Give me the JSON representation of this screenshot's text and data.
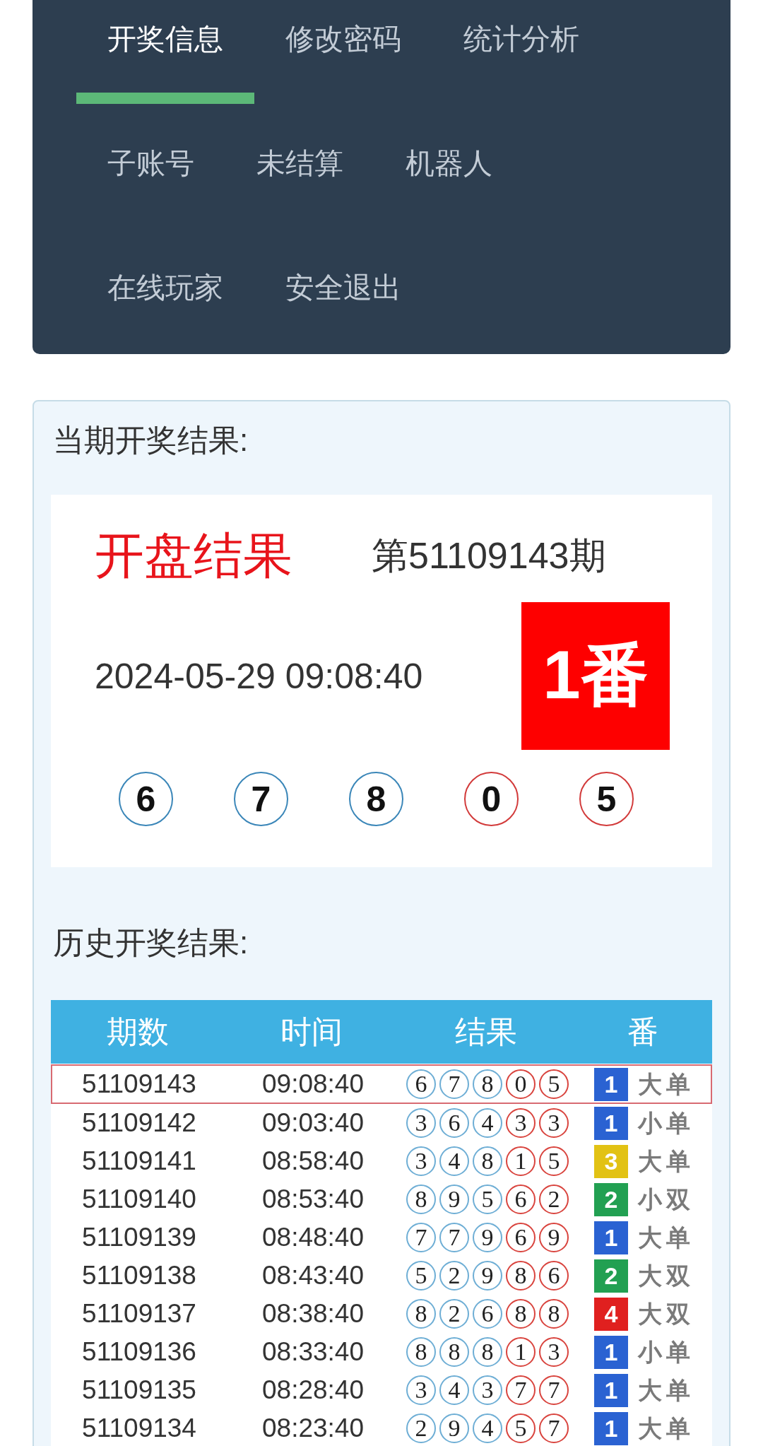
{
  "nav": {
    "tabs": [
      {
        "label": "开奖信息",
        "selected": true
      },
      {
        "label": "修改密码",
        "selected": false
      },
      {
        "label": "统计分析",
        "selected": false
      },
      {
        "label": "子账号",
        "selected": false
      },
      {
        "label": "未结算",
        "selected": false
      },
      {
        "label": "机器人",
        "selected": false
      },
      {
        "label": "在线玩家",
        "selected": false
      },
      {
        "label": "安全退出",
        "selected": false
      }
    ]
  },
  "current": {
    "heading": "当期开奖结果:",
    "title": "开盘结果",
    "period": "第51109143期",
    "time": "2024-05-29 09:08:40",
    "fan_badge": "1番",
    "balls": [
      {
        "number": "6",
        "color": "#3a86b8"
      },
      {
        "number": "7",
        "color": "#3a86b8"
      },
      {
        "number": "8",
        "color": "#3a86b8"
      },
      {
        "number": "0",
        "color": "#d23a3a"
      },
      {
        "number": "5",
        "color": "#d23a3a"
      }
    ]
  },
  "history": {
    "heading": "历史开奖结果:",
    "columns": [
      "期数",
      "时间",
      "结果",
      "番"
    ],
    "rows": [
      {
        "period": "51109143",
        "time": "09:08:40",
        "selected": true,
        "result": [
          {
            "number": "6",
            "color": "#6eaed5"
          },
          {
            "number": "7",
            "color": "#6eaed5"
          },
          {
            "number": "8",
            "color": "#6eaed5"
          },
          {
            "number": "0",
            "color": "#d9443e"
          },
          {
            "number": "5",
            "color": "#d9443e"
          }
        ],
        "fan": {
          "number": "1",
          "color": "#2a62d2"
        },
        "label": "大单"
      },
      {
        "period": "51109142",
        "time": "09:03:40",
        "selected": false,
        "result": [
          {
            "number": "3",
            "color": "#6eaed5"
          },
          {
            "number": "6",
            "color": "#6eaed5"
          },
          {
            "number": "4",
            "color": "#6eaed5"
          },
          {
            "number": "3",
            "color": "#d9443e"
          },
          {
            "number": "3",
            "color": "#d9443e"
          }
        ],
        "fan": {
          "number": "1",
          "color": "#2a62d2"
        },
        "label": "小单"
      },
      {
        "period": "51109141",
        "time": "08:58:40",
        "selected": false,
        "result": [
          {
            "number": "3",
            "color": "#6eaed5"
          },
          {
            "number": "4",
            "color": "#6eaed5"
          },
          {
            "number": "8",
            "color": "#6eaed5"
          },
          {
            "number": "1",
            "color": "#d9443e"
          },
          {
            "number": "5",
            "color": "#d9443e"
          }
        ],
        "fan": {
          "number": "3",
          "color": "#e2c214"
        },
        "label": "大单"
      },
      {
        "period": "51109140",
        "time": "08:53:40",
        "selected": false,
        "result": [
          {
            "number": "8",
            "color": "#6eaed5"
          },
          {
            "number": "9",
            "color": "#6eaed5"
          },
          {
            "number": "5",
            "color": "#6eaed5"
          },
          {
            "number": "6",
            "color": "#d9443e"
          },
          {
            "number": "2",
            "color": "#d9443e"
          }
        ],
        "fan": {
          "number": "2",
          "color": "#22a052"
        },
        "label": "小双"
      },
      {
        "period": "51109139",
        "time": "08:48:40",
        "selected": false,
        "result": [
          {
            "number": "7",
            "color": "#6eaed5"
          },
          {
            "number": "7",
            "color": "#6eaed5"
          },
          {
            "number": "9",
            "color": "#6eaed5"
          },
          {
            "number": "6",
            "color": "#d9443e"
          },
          {
            "number": "9",
            "color": "#d9443e"
          }
        ],
        "fan": {
          "number": "1",
          "color": "#2a62d2"
        },
        "label": "大单"
      },
      {
        "period": "51109138",
        "time": "08:43:40",
        "selected": false,
        "result": [
          {
            "number": "5",
            "color": "#6eaed5"
          },
          {
            "number": "2",
            "color": "#6eaed5"
          },
          {
            "number": "9",
            "color": "#6eaed5"
          },
          {
            "number": "8",
            "color": "#d9443e"
          },
          {
            "number": "6",
            "color": "#d9443e"
          }
        ],
        "fan": {
          "number": "2",
          "color": "#22a052"
        },
        "label": "大双"
      },
      {
        "period": "51109137",
        "time": "08:38:40",
        "selected": false,
        "result": [
          {
            "number": "8",
            "color": "#6eaed5"
          },
          {
            "number": "2",
            "color": "#6eaed5"
          },
          {
            "number": "6",
            "color": "#6eaed5"
          },
          {
            "number": "8",
            "color": "#d9443e"
          },
          {
            "number": "8",
            "color": "#d9443e"
          }
        ],
        "fan": {
          "number": "4",
          "color": "#e0201f"
        },
        "label": "大双"
      },
      {
        "period": "51109136",
        "time": "08:33:40",
        "selected": false,
        "result": [
          {
            "number": "8",
            "color": "#6eaed5"
          },
          {
            "number": "8",
            "color": "#6eaed5"
          },
          {
            "number": "8",
            "color": "#6eaed5"
          },
          {
            "number": "1",
            "color": "#d9443e"
          },
          {
            "number": "3",
            "color": "#d9443e"
          }
        ],
        "fan": {
          "number": "1",
          "color": "#2a62d2"
        },
        "label": "小单"
      },
      {
        "period": "51109135",
        "time": "08:28:40",
        "selected": false,
        "result": [
          {
            "number": "3",
            "color": "#6eaed5"
          },
          {
            "number": "4",
            "color": "#6eaed5"
          },
          {
            "number": "3",
            "color": "#6eaed5"
          },
          {
            "number": "7",
            "color": "#d9443e"
          },
          {
            "number": "7",
            "color": "#d9443e"
          }
        ],
        "fan": {
          "number": "1",
          "color": "#2a62d2"
        },
        "label": "大单"
      },
      {
        "period": "51109134",
        "time": "08:23:40",
        "selected": false,
        "result": [
          {
            "number": "2",
            "color": "#6eaed5"
          },
          {
            "number": "9",
            "color": "#6eaed5"
          },
          {
            "number": "4",
            "color": "#6eaed5"
          },
          {
            "number": "5",
            "color": "#d9443e"
          },
          {
            "number": "7",
            "color": "#d9443e"
          }
        ],
        "fan": {
          "number": "1",
          "color": "#2a62d2"
        },
        "label": "大单"
      }
    ]
  }
}
